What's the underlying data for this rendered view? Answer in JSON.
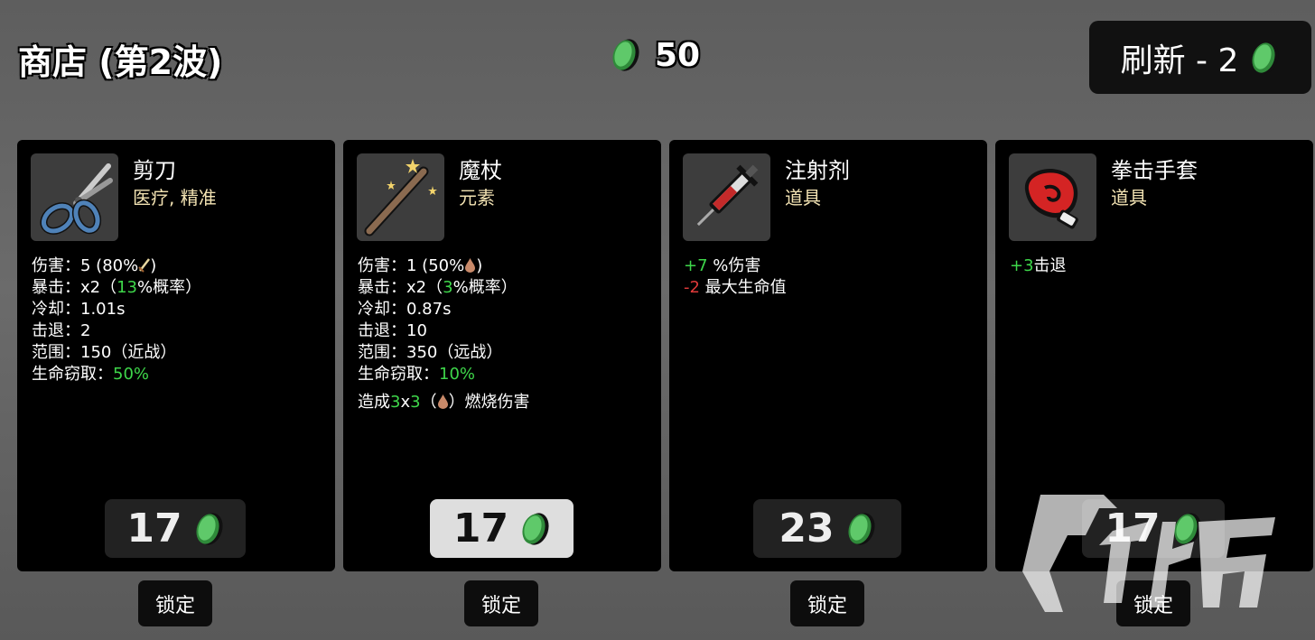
{
  "header": {
    "title": "商店 (第2波)",
    "materials": "50",
    "reroll_label": "刷新 - 2"
  },
  "cards": [
    {
      "name": "剪刀",
      "tags": "医疗, 精准",
      "icon": "scissors-icon",
      "stats": [
        {
          "label": "伤害：",
          "value": "5 (80%",
          "suffix": ")"
        },
        {
          "label": "暴击：",
          "value": "x2（",
          "g": "13",
          "tail": "%概率）"
        },
        {
          "label": "冷却：",
          "value": "1.01s"
        },
        {
          "label": "击退：",
          "value": "2"
        },
        {
          "label": "范围：",
          "value": "150（近战）"
        },
        {
          "label": "生命窃取：",
          "g": "50%"
        }
      ],
      "price": "17",
      "lock": "锁定"
    },
    {
      "name": "魔杖",
      "tags": "元素",
      "icon": "wand-icon",
      "stats": [
        {
          "label": "伤害：",
          "value": "1 (50%",
          "suffix": ")"
        },
        {
          "label": "暴击：",
          "value": "x2（",
          "g": "3",
          "tail": "%概率）"
        },
        {
          "label": "冷却：",
          "value": "0.87s"
        },
        {
          "label": "击退：",
          "value": "10"
        },
        {
          "label": "范围：",
          "value": "350（远战）"
        },
        {
          "label": "生命窃取：",
          "g": "10%"
        }
      ],
      "extra": {
        "pre": "造成",
        "a": "3",
        "x": "x",
        "b": "3",
        "paren_open": "（",
        "paren_close": "）燃烧伤害"
      },
      "price": "17",
      "lock": "锁定"
    },
    {
      "name": "注射剂",
      "tags": "道具",
      "icon": "syringe-icon",
      "effects": [
        {
          "sign": "+7",
          "text": " %伤害",
          "color": "g"
        },
        {
          "sign": "-2",
          "text": " 最大生命值",
          "color": "r"
        }
      ],
      "price": "23",
      "lock": "锁定"
    },
    {
      "name": "拳击手套",
      "tags": "道具",
      "icon": "boxing-glove-icon",
      "effects": [
        {
          "sign": "+3",
          "text": "击退",
          "color": "g"
        }
      ],
      "price": "17",
      "lock": "锁定"
    }
  ],
  "colors": {
    "material_green": "#5fc96a",
    "highlight_green": "#3ed64a",
    "negative_red": "#e03a3a",
    "tag_color": "#f3e3b3"
  }
}
